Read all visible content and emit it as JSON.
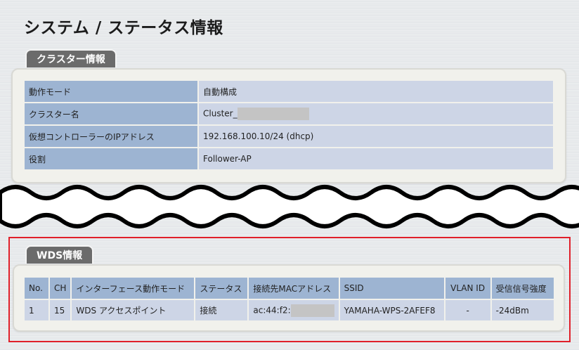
{
  "page": {
    "title": "システム / ステータス情報"
  },
  "cluster": {
    "tab_label": "クラスター情報",
    "rows": [
      {
        "key": "動作モード",
        "value": "自動構成"
      },
      {
        "key": "クラスター名",
        "value": "Cluster_"
      },
      {
        "key": "仮想コントローラーのIPアドレス",
        "value": "192.168.100.10/24 (dhcp)"
      },
      {
        "key": "役割",
        "value": "Follower-AP"
      }
    ]
  },
  "wds": {
    "tab_label": "WDS情報",
    "headers": [
      "No.",
      "CH",
      "インターフェース動作モード",
      "ステータス",
      "接続先MACアドレス",
      "SSID",
      "VLAN ID",
      "受信信号強度"
    ],
    "row": {
      "no": "1",
      "ch": "15",
      "mode": "WDS アクセスポイント",
      "status": "接続",
      "mac": "ac:44:f2:",
      "ssid": "YAMAHA-WPS-2AFEF8",
      "vlan": "-",
      "rssi": "-24dBm"
    }
  },
  "colors": {
    "highlight": "#e0202a",
    "key_cell": "#9db4d2",
    "value_cell": "#cdd5e6",
    "tab": "#6b6b6b"
  }
}
